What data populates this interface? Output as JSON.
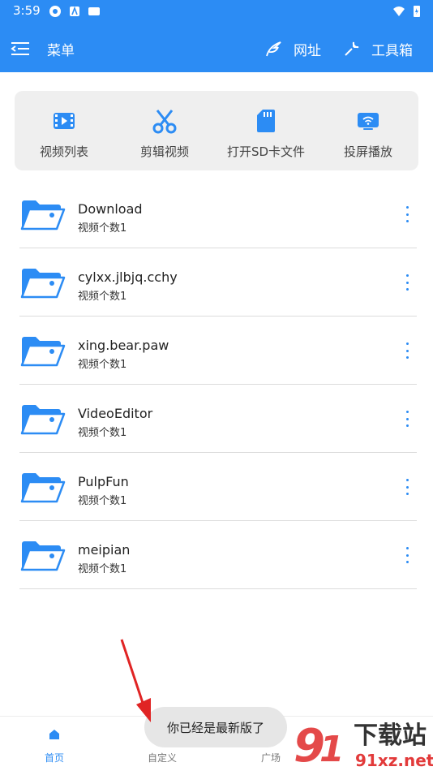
{
  "status_bar": {
    "time": "3:59"
  },
  "app_bar": {
    "menu_label": "菜单",
    "url_label": "网址",
    "toolbox_label": "工具箱"
  },
  "quick_actions": [
    {
      "label": "视频列表",
      "icon": "video-list-icon"
    },
    {
      "label": "剪辑视频",
      "icon": "scissors-icon"
    },
    {
      "label": "打开SD卡文件",
      "icon": "sd-card-icon"
    },
    {
      "label": "投屏播放",
      "icon": "cast-icon"
    }
  ],
  "folders": [
    {
      "name": "Download",
      "count": "视频个数1"
    },
    {
      "name": "cylxx.jlbjq.cchy",
      "count": "视频个数1"
    },
    {
      "name": "xing.bear.paw",
      "count": "视频个数1"
    },
    {
      "name": "VideoEditor",
      "count": "视频个数1"
    },
    {
      "name": "PulpFun",
      "count": "视频个数1"
    },
    {
      "name": "meipian",
      "count": "视频个数1"
    }
  ],
  "bottom_nav": [
    {
      "label": "首页",
      "active": true
    },
    {
      "label": "自定义",
      "active": false
    },
    {
      "label": "广场",
      "active": false
    }
  ],
  "toast": {
    "text": "你已经是最新版了"
  },
  "watermark": {
    "text": "下载站",
    "domain": "91xz.net"
  },
  "colors": {
    "primary": "#2c8cf4",
    "annotation_arrow": "#e02424",
    "watermark": "#e23a3a"
  }
}
